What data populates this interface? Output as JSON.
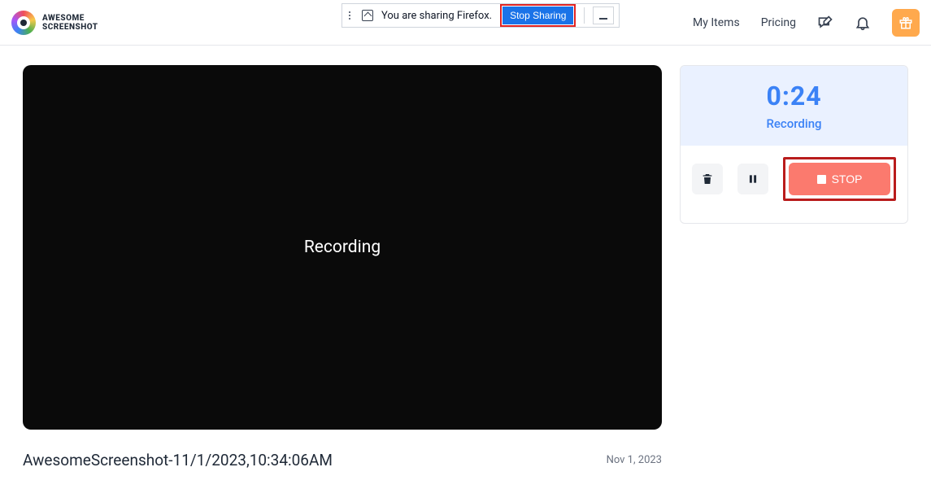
{
  "brand": {
    "line1": "AWESOME",
    "line2": "SCREENSHOT"
  },
  "shareBar": {
    "message": "You are sharing Firefox.",
    "stopLabel": "Stop Sharing"
  },
  "nav": {
    "myItems": "My Items",
    "pricing": "Pricing"
  },
  "stage": {
    "label": "Recording"
  },
  "meta": {
    "title": "AwesomeScreenshot-11/1/2023,10:34:06AM",
    "date": "Nov 1, 2023"
  },
  "panel": {
    "timer": "0:24",
    "status": "Recording",
    "stopLabel": "STOP"
  }
}
